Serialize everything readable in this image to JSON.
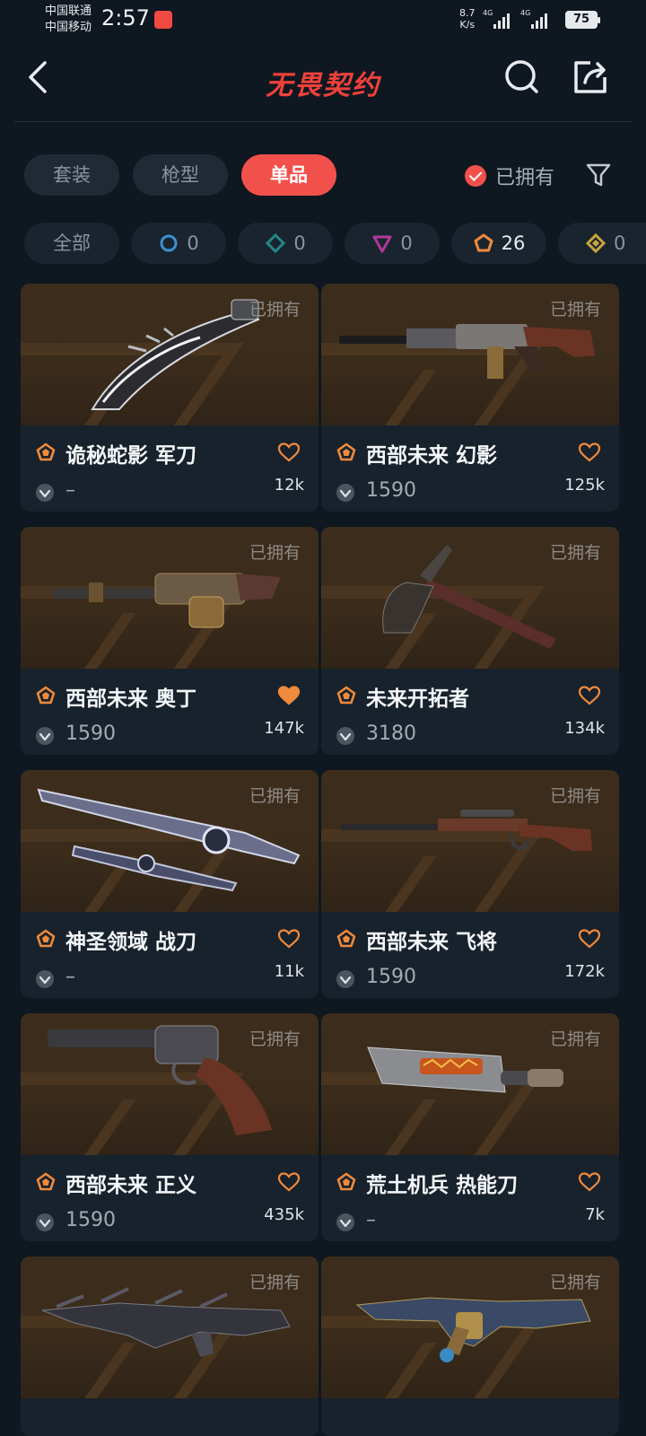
{
  "status_bar": {
    "carrier1": "中国联通",
    "carrier2": "中国移动",
    "time": "2:57",
    "net_speed_value": "8.7",
    "net_speed_unit": "K/s",
    "signal1": "4G",
    "signal2": "4G",
    "battery": "75"
  },
  "header": {
    "title": "无畏契约",
    "back_icon": "chevron-left-icon",
    "search_icon": "search-icon",
    "share_icon": "share-icon"
  },
  "tabs": [
    {
      "label": "套装",
      "active": false
    },
    {
      "label": "枪型",
      "active": false
    },
    {
      "label": "单品",
      "active": true
    }
  ],
  "owned_filter": {
    "label": "已拥有",
    "checked": true
  },
  "tiers": [
    {
      "label": "全部",
      "icon": "",
      "count": ""
    },
    {
      "label": "",
      "icon": "select-tier-icon",
      "count": "0",
      "color": "#3b8fd4"
    },
    {
      "label": "",
      "icon": "deluxe-tier-icon",
      "count": "0",
      "color": "#1f8a84"
    },
    {
      "label": "",
      "icon": "premium-tier-icon",
      "count": "0",
      "color": "#b0389c"
    },
    {
      "label": "",
      "icon": "exclusive-tier-icon",
      "count": "26",
      "color": "#f08a3c"
    },
    {
      "label": "",
      "icon": "ultra-tier-icon",
      "count": "0",
      "color": "#c8a43c"
    }
  ],
  "items": [
    {
      "name": "诡秘蛇影 军刀",
      "price": "–",
      "likes": "12k",
      "owned": "已拥有",
      "liked": false,
      "weapon": "karambit"
    },
    {
      "name": "西部未来 幻影",
      "price": "1590",
      "likes": "125k",
      "owned": "已拥有",
      "liked": false,
      "weapon": "rifle"
    },
    {
      "name": "西部未来 奥丁",
      "price": "1590",
      "likes": "147k",
      "owned": "已拥有",
      "liked": true,
      "weapon": "minigun"
    },
    {
      "name": "未来开拓者",
      "price": "3180",
      "likes": "134k",
      "owned": "已拥有",
      "liked": false,
      "weapon": "axe"
    },
    {
      "name": "神圣领域 战刀",
      "price": "–",
      "likes": "11k",
      "owned": "已拥有",
      "liked": false,
      "weapon": "blades"
    },
    {
      "name": "西部未来 飞将",
      "price": "1590",
      "likes": "172k",
      "owned": "已拥有",
      "liked": false,
      "weapon": "lever-rifle"
    },
    {
      "name": "西部未来 正义",
      "price": "1590",
      "likes": "435k",
      "owned": "已拥有",
      "liked": false,
      "weapon": "revolver"
    },
    {
      "name": "荒土机兵 热能刀",
      "price": "–",
      "likes": "7k",
      "owned": "已拥有",
      "liked": false,
      "weapon": "heat-blade"
    },
    {
      "name": "",
      "price": "",
      "likes": "",
      "owned": "已拥有",
      "liked": false,
      "weapon": "spiky-rifle"
    },
    {
      "name": "",
      "price": "",
      "likes": "",
      "owned": "已拥有",
      "liked": false,
      "weapon": "ornate-rifle"
    }
  ],
  "colors": {
    "accent": "#f2514b",
    "tier_exclusive": "#f08a3c",
    "background": "#0f1720"
  }
}
